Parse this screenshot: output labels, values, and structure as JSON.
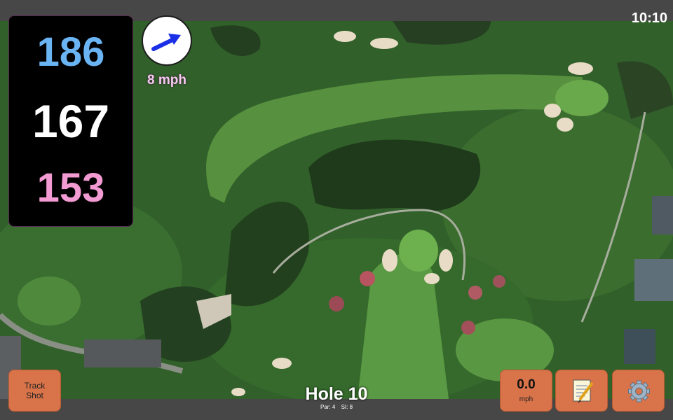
{
  "status": {
    "time": "10:10"
  },
  "yardages": {
    "front": "186",
    "middle": "167",
    "back": "153"
  },
  "wind": {
    "speed": "8 mph",
    "icon": "wind-direction-arrow-icon"
  },
  "hole": {
    "title": "Hole 10",
    "par": "Par: 4",
    "si": "SI: 8"
  },
  "buttons": {
    "track_line1": "Track",
    "track_line2": "Shot",
    "speed_value": "0.0",
    "speed_unit": "mph",
    "notes_icon": "notepad-icon",
    "settings_icon": "gear-icon"
  },
  "colors": {
    "front": "#6ab4f4",
    "middle": "#ffffff",
    "back": "#f29ad2",
    "button": "#d8734a",
    "wind_arrow": "#1a2fe6"
  }
}
